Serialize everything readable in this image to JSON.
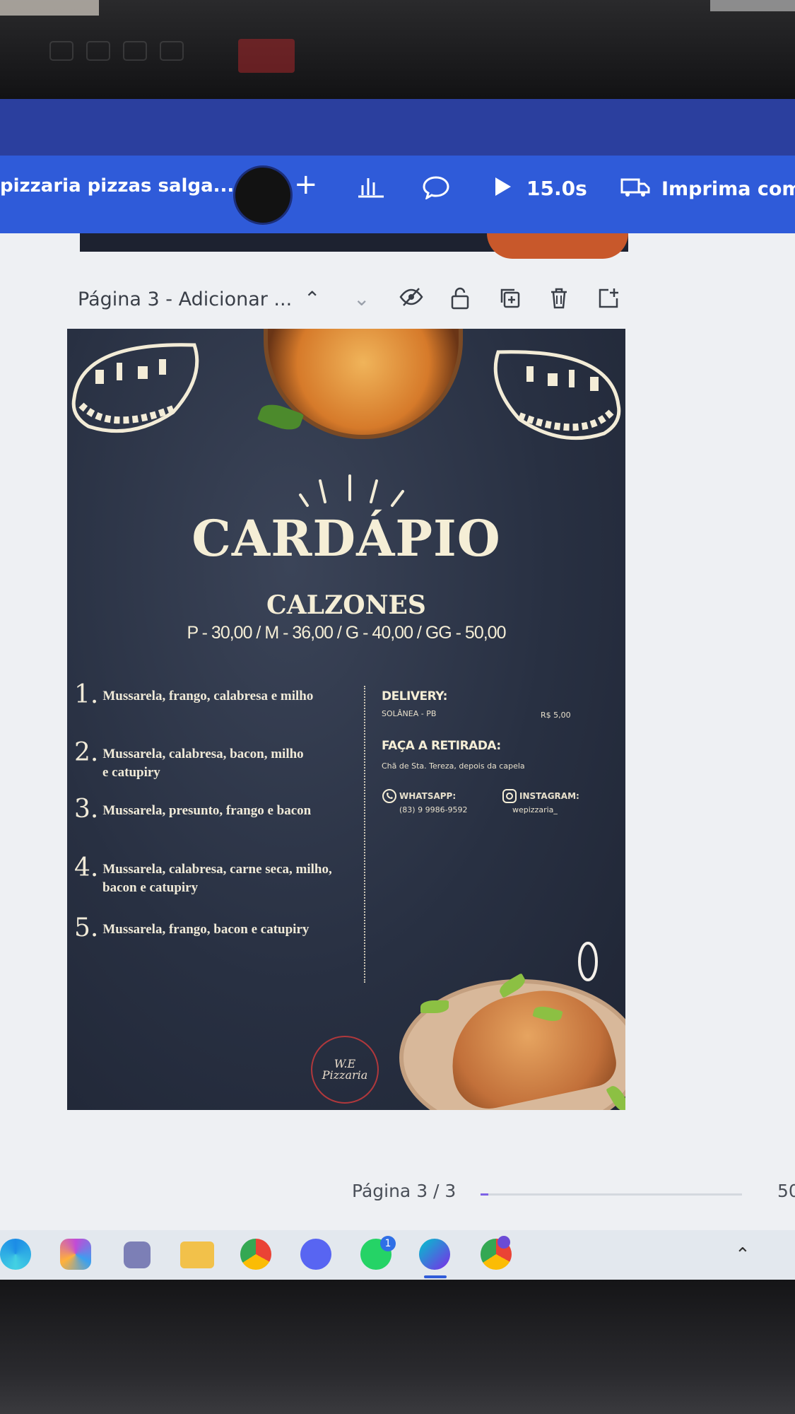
{
  "editor": {
    "doc_title": "pizzaria pizzas salga...",
    "duration": "15.0s",
    "print_label": "Imprima com o",
    "page_label": "Página 3 - Adicionar ...",
    "pager": "Página 3 / 3",
    "zoom": "50",
    "progress": 0.03,
    "whatsapp_badge": "1"
  },
  "menu": {
    "title": "CARDÁPIO",
    "subtitle": "CALZONES",
    "prices": "P - 30,00 / M - 36,00 / G - 40,00 / GG - 50,00",
    "items": [
      {
        "num": "1.",
        "line1": "Mussarela, frango, calabresa e milho",
        "line2": ""
      },
      {
        "num": "2.",
        "line1": "Mussarela, calabresa, bacon, milho",
        "line2": "e catupiry"
      },
      {
        "num": "3.",
        "line1": "Mussarela, presunto, frango e bacon",
        "line2": ""
      },
      {
        "num": "4.",
        "line1": "Mussarela, calabresa, carne seca, milho,",
        "line2": "bacon e catupiry"
      },
      {
        "num": "5.",
        "line1": "Mussarela, frango, bacon e catupiry",
        "line2": ""
      }
    ],
    "delivery": {
      "label": "DELIVERY:",
      "place": "SOLÂNEA - PB",
      "price": "R$ 5,00"
    },
    "pickup": {
      "label": "FAÇA A RETIRADA:",
      "address": "Chã de Sta. Tereza, depois da capela"
    },
    "whatsapp": {
      "label": "WHATSAPP:",
      "value": "(83) 9 9986-9592"
    },
    "instagram": {
      "label": "INSTAGRAM:",
      "value": "wepizzaria_"
    },
    "logo": {
      "line1": "W.E",
      "line2": "Pizzaria"
    }
  }
}
